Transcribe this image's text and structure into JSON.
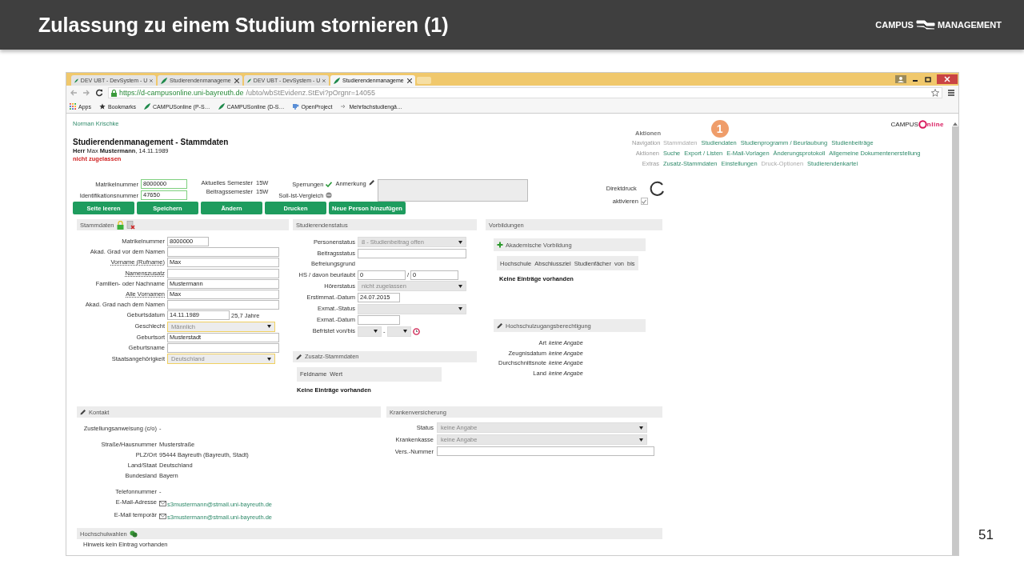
{
  "slide": {
    "title": "Zulassung zu einem Studium stornieren (1)",
    "logo": {
      "left": "CAMPUS",
      "right": "MANAGEMENT"
    },
    "page_number": "51"
  },
  "browser": {
    "tabs": [
      {
        "label": "DEV UBT - DevSystem - U",
        "selected": false
      },
      {
        "label": "Studierendenmanageme",
        "selected": false
      },
      {
        "label": "DEV UBT - DevSystem - U",
        "selected": false
      },
      {
        "label": "Studierendenmanageme",
        "selected": true
      }
    ],
    "url": {
      "host": "https://d-campusonline.uni-bayreuth.de",
      "path": "/ubto/wbStEvidenz.StEvi?pOrgnr=14055"
    },
    "bookmarks": [
      {
        "kind": "apps",
        "label": "Apps"
      },
      {
        "kind": "star",
        "label": "Bookmarks"
      },
      {
        "kind": "leaf",
        "label": "CAMPUSonline (P-S…"
      },
      {
        "kind": "leaf",
        "label": "CAMPUSonline (D-S…"
      },
      {
        "kind": "puzzle",
        "label": "OpenProject"
      },
      {
        "kind": "arrow",
        "label": "Mehrfachstudiengä…"
      }
    ]
  },
  "page": {
    "user": "Norman Krischke",
    "logo": {
      "left": "CAMPUS",
      "right": "nline"
    },
    "title": "Studierendenmanagement - Stammdaten",
    "person": "**Herr** Max **Mustermann**, 14.11.1989",
    "status": "nicht zugelassen",
    "actions": {
      "heading": "Aktionen",
      "rows": [
        {
          "label": "Navigation",
          "links": [
            {
              "text": "Stammdaten",
              "disabled": true
            },
            {
              "text": "Studiendaten",
              "disabled": false,
              "callout": "1"
            },
            {
              "text": "Studienprogramm / Beurlaubung",
              "disabled": false
            },
            {
              "text": "Studienbeiträge",
              "disabled": false
            }
          ]
        },
        {
          "label": "Aktionen",
          "links": [
            {
              "text": "Suche",
              "disabled": false
            },
            {
              "text": "Export / Listen",
              "disabled": false
            },
            {
              "text": "E-Mail-Vorlagen",
              "disabled": false
            },
            {
              "text": "Änderungsprotokoll",
              "disabled": false
            },
            {
              "text": "Allgemeine Dokumentenerstellung",
              "disabled": false
            }
          ]
        },
        {
          "label": "Extras",
          "links": [
            {
              "text": "Zusatz-Stammdaten",
              "disabled": false
            },
            {
              "text": "Einstellungen",
              "disabled": false
            },
            {
              "text": "Druck-Optionen",
              "disabled": true
            },
            {
              "text": "Studierendenkartei",
              "disabled": false
            }
          ]
        }
      ]
    },
    "ids": [
      {
        "label": "Matrikelnummer",
        "value": "8000000"
      },
      {
        "label": "Identifikationsnummer",
        "value": "47650"
      }
    ],
    "semesters": [
      {
        "label": "Aktuelles Semester",
        "value": "15W"
      },
      {
        "label": "Beitragssemester",
        "value": "15W"
      }
    ],
    "flags": [
      {
        "label": "Sperrungen",
        "kind": "check"
      },
      {
        "label": "Soll-Ist-Vergleich",
        "kind": "dot"
      }
    ],
    "note": {
      "label": "Anmerkung"
    },
    "direct_print": {
      "label": "Direktdruck",
      "checkbox_label": "aktivieren",
      "checked": true
    },
    "buttons": [
      "Seite leeren",
      "Speichern",
      "Ändern",
      "Drucken",
      "Neue Person hinzufügen"
    ],
    "stammdaten": {
      "title": "Stammdaten",
      "fields": [
        {
          "kind": "short",
          "label": "Matrikelnummer",
          "value": "8000000",
          "underlined": false
        },
        {
          "kind": "input",
          "label": "Akad. Grad vor dem Namen",
          "underlined": false
        },
        {
          "kind": "input",
          "label": "Vorname (Rufname)",
          "value": "Max",
          "underlined": true
        },
        {
          "kind": "input",
          "label": "Namenszusatz",
          "underlined": true
        },
        {
          "kind": "input",
          "label": "Familien- oder Nachname",
          "value": "Mustermann",
          "underlined": false
        },
        {
          "kind": "input",
          "label": "Alle Vornamen",
          "value": "Max",
          "underlined": true
        },
        {
          "kind": "input",
          "label": "Akad. Grad nach dem Namen",
          "underlined": false
        },
        {
          "kind": "date",
          "label": "Geburtsdatum",
          "value": "14.11.1989",
          "suffix": "25,7 Jahre",
          "underlined": false
        },
        {
          "kind": "select",
          "label": "Geschlecht",
          "value": "Männlich",
          "underlined": false
        },
        {
          "kind": "input",
          "label": "Geburtsort",
          "value": "Musterstadt",
          "underlined": false
        },
        {
          "kind": "input",
          "label": "Geburtsname",
          "underlined": false
        },
        {
          "kind": "select",
          "label": "Staatsangehörigkeit",
          "value": "Deutschland",
          "underlined": false
        }
      ]
    },
    "studierendenstatus": {
      "title": "Studierendenstatus",
      "fields": [
        {
          "kind": "select",
          "label": "Personenstatus",
          "value": "8 - Studienbeitrag offen"
        },
        {
          "kind": "input",
          "label": "Beitragsstatus"
        },
        {
          "kind": "text",
          "label": "Befreiungsgrund"
        },
        {
          "kind": "pair",
          "label": "HS / davon beurlaubt",
          "values": [
            "0",
            "0"
          ],
          "separator": "/"
        },
        {
          "kind": "select",
          "label": "Hörerstatus",
          "value": "nicht zugelassen"
        },
        {
          "kind": "date",
          "label": "Erstimmat.-Datum",
          "value": "24.07.2015"
        },
        {
          "kind": "select",
          "label": "Exmat.-Status"
        },
        {
          "kind": "date",
          "label": "Exmat.-Datum"
        },
        {
          "kind": "range",
          "label": "Befristet von/bis",
          "separator": "-"
        }
      ]
    },
    "zusatz": {
      "title": "Zusatz-Stammdaten",
      "columns": [
        "Feldname",
        "Wert"
      ],
      "empty": "Keine Einträge vorhanden"
    },
    "vorbildungen": {
      "title": "Vorbildungen",
      "academic": {
        "title": "Akademische Vorbildung",
        "columns": [
          "Hochschule",
          "Abschlussziel",
          "Studienfächer",
          "von",
          "bis"
        ],
        "empty": "Keine Einträge vorhanden"
      },
      "hzb": {
        "title": "Hochschulzugangsberechtigung",
        "rows": [
          {
            "label": "Art",
            "value": "keine Angabe"
          },
          {
            "label": "Zeugnisdatum",
            "value": "keine Angabe"
          },
          {
            "label": "Durchschnittsnote",
            "value": "keine Angabe"
          },
          {
            "label": "Land",
            "value": "keine Angabe"
          }
        ]
      }
    },
    "kontakt": {
      "title": "Kontakt",
      "groups": [
        {
          "rows": [
            {
              "kind": "text",
              "label": "Zustellungsanweisung (c/o)",
              "value": "-"
            }
          ]
        },
        {
          "rows": [
            {
              "kind": "text",
              "label": "Straße/Hausnummer",
              "value": "Musterstraße"
            },
            {
              "kind": "text",
              "label": "PLZ/Ort",
              "value": "95444 Bayreuth (Bayreuth, Stadt)"
            },
            {
              "kind": "text",
              "label": "Land/Staat",
              "value": "Deutschland"
            },
            {
              "kind": "text",
              "label": "Bundesland",
              "value": "Bayern"
            }
          ]
        },
        {
          "rows": [
            {
              "kind": "text",
              "label": "Telefonnummer",
              "value": "-"
            },
            {
              "kind": "email",
              "label": "E-Mail-Adresse",
              "value": "s3mustermann@stmail.uni-bayreuth.de"
            },
            {
              "kind": "email",
              "label": "E-Mail temporär",
              "value": "s3mustermann@stmail.uni-bayreuth.de"
            }
          ]
        }
      ]
    },
    "krankenversicherung": {
      "title": "Krankenversicherung",
      "fields": [
        {
          "kind": "select",
          "label": "Status",
          "value": "keine Angabe"
        },
        {
          "kind": "select",
          "label": "Krankenkasse",
          "value": "keine Angabe"
        },
        {
          "kind": "input",
          "label": "Vers.-Nummer"
        }
      ]
    },
    "hochschulwahlen": {
      "title": "Hochschulwahlen",
      "hint": "Hinweis kein Eintrag vorhanden"
    }
  }
}
